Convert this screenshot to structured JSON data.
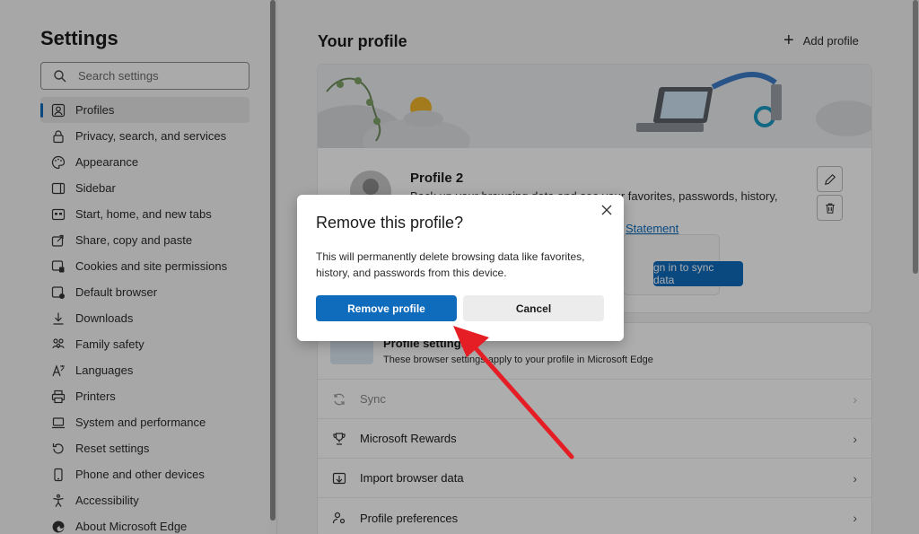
{
  "sidebar": {
    "title": "Settings",
    "search_placeholder": "Search settings",
    "items": [
      {
        "label": "Profiles",
        "icon": "profile-icon",
        "active": true
      },
      {
        "label": "Privacy, search, and services",
        "icon": "lock-icon"
      },
      {
        "label": "Appearance",
        "icon": "palette-icon"
      },
      {
        "label": "Sidebar",
        "icon": "sidebar-icon"
      },
      {
        "label": "Start, home, and new tabs",
        "icon": "home-tabs-icon"
      },
      {
        "label": "Share, copy and paste",
        "icon": "share-icon"
      },
      {
        "label": "Cookies and site permissions",
        "icon": "cookie-icon"
      },
      {
        "label": "Default browser",
        "icon": "browser-icon"
      },
      {
        "label": "Downloads",
        "icon": "download-icon"
      },
      {
        "label": "Family safety",
        "icon": "family-icon"
      },
      {
        "label": "Languages",
        "icon": "language-icon"
      },
      {
        "label": "Printers",
        "icon": "printer-icon"
      },
      {
        "label": "System and performance",
        "icon": "laptop-icon"
      },
      {
        "label": "Reset settings",
        "icon": "reset-icon"
      },
      {
        "label": "Phone and other devices",
        "icon": "phone-icon"
      },
      {
        "label": "Accessibility",
        "icon": "accessibility-icon"
      },
      {
        "label": "About Microsoft Edge",
        "icon": "edge-icon"
      }
    ]
  },
  "main": {
    "title": "Your profile",
    "add_profile": "Add profile",
    "profile": {
      "name": "Profile 2",
      "description_partial": "Back up your browsing data and see your favorites, passwords, history, and",
      "link_partial": "Statement",
      "sync_button_partial": "gn in to sync data"
    },
    "profile_settings": {
      "title": "Profile settings",
      "subtitle": "These browser settings apply to your profile in Microsoft Edge"
    },
    "rows": [
      {
        "label": "Sync",
        "icon": "sync-icon",
        "disabled": true
      },
      {
        "label": "Microsoft Rewards",
        "icon": "trophy-icon"
      },
      {
        "label": "Import browser data",
        "icon": "import-icon"
      },
      {
        "label": "Profile preferences",
        "icon": "preferences-icon"
      }
    ]
  },
  "dialog": {
    "title": "Remove this profile?",
    "body": "This will permanently delete browsing data like favorites, history, and passwords from this device.",
    "primary": "Remove profile",
    "secondary": "Cancel"
  },
  "colors": {
    "accent": "#0f6cbd",
    "annotation_arrow": "#e51d24"
  }
}
